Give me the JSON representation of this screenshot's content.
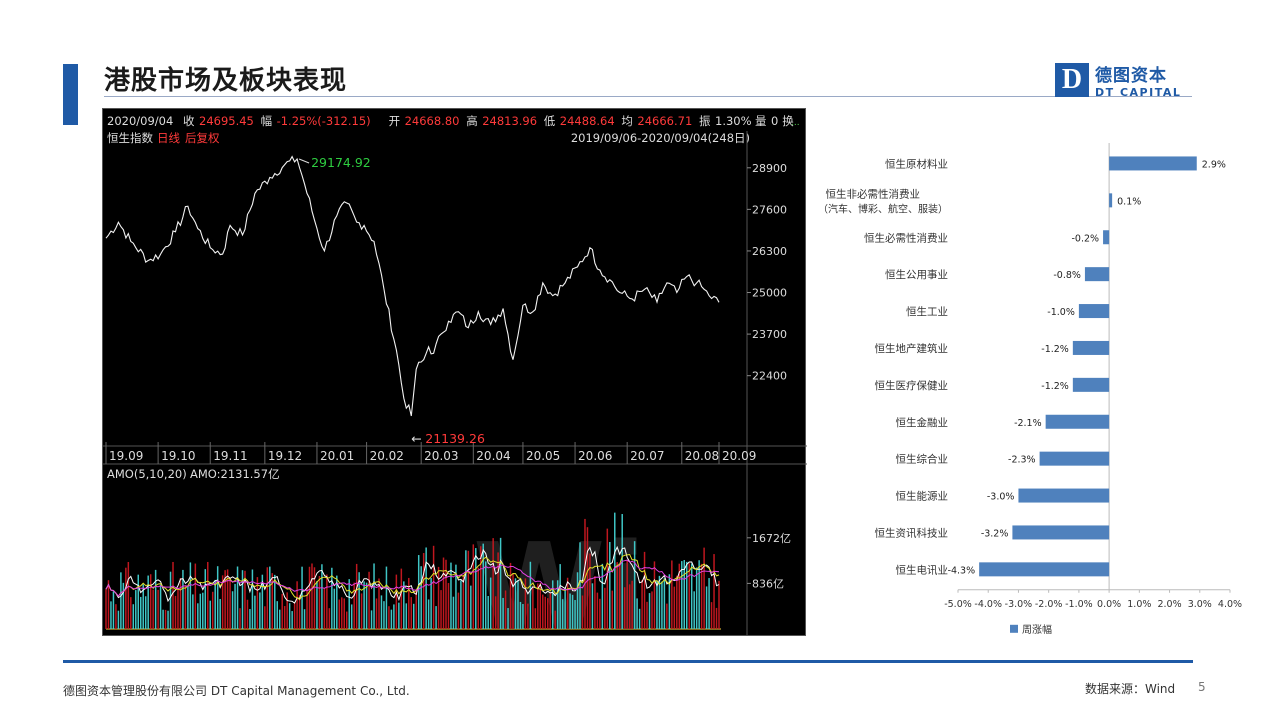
{
  "slide": {
    "title": "港股市场及板块表现",
    "logo_letter": "D",
    "logo_cn": "德图资本",
    "logo_en": "DT CAPITAL",
    "footer_left": "德图资本管理股份有限公司  DT Capital  Management  Co., Ltd.",
    "footer_source": "数据来源：Wind",
    "page_number": "5"
  },
  "chart_data": [
    {
      "type": "line",
      "title": "恒生指数",
      "header": {
        "date": "2020/09/04",
        "close_label": "收",
        "close": "24695.45",
        "change_label": "幅",
        "change": "-1.25%(-312.15)",
        "open_label": "开",
        "open": "24668.80",
        "high_label": "高",
        "high": "24813.96",
        "low_label": "低",
        "low": "24488.64",
        "avg_label": "均",
        "avg": "24666.71",
        "amp_label": "振",
        "amp": "1.30%",
        "vol_label": "量",
        "vol": "0",
        "turnover_label": "换",
        "period_tag": "日线",
        "adj_tag": "后复权",
        "range": "2019/09/06-2020/09/04(248日)"
      },
      "ylim": [
        21139.26,
        29174.92
      ],
      "y_ticks": [
        "28900",
        "27600",
        "26300",
        "25000",
        "23700",
        "22400"
      ],
      "x_ticks": [
        "19.09",
        "19.10",
        "19.11",
        "19.12",
        "20.01",
        "20.02",
        "20.03",
        "20.04",
        "20.05",
        "20.06",
        "20.07",
        "20.08",
        "20.09"
      ],
      "annotations": {
        "max": "29174.92",
        "min": "21139.26"
      },
      "series": [
        {
          "x": [
            0,
            5,
            10,
            17,
            22,
            28,
            33,
            37,
            42,
            47,
            50,
            55,
            60,
            66,
            72,
            77,
            80,
            85,
            88,
            93,
            97,
            101,
            104,
            108,
            112,
            117,
            120,
            123,
            125,
            128,
            130,
            132,
            135,
            138,
            142,
            146,
            150,
            155,
            160,
            164,
            168,
            172,
            176,
            180,
            185,
            190,
            195,
            199,
            203,
            207,
            212,
            217,
            222,
            226,
            230,
            234,
            238,
            241,
            243,
            247
          ],
          "values": [
            26700,
            27200,
            26600,
            26000,
            26200,
            26900,
            27700,
            27000,
            26400,
            26200,
            27100,
            26800,
            28100,
            28600,
            29000,
            29174.92,
            28400,
            27000,
            26300,
            27400,
            27800,
            27200,
            27100,
            26600,
            25100,
            23200,
            21700,
            21139.26,
            22600,
            22900,
            23300,
            23100,
            23700,
            24100,
            24400,
            23900,
            24400,
            24000,
            24500,
            22900,
            24600,
            24400,
            25300,
            24900,
            25300,
            25800,
            26400,
            25700,
            25400,
            25000,
            24800,
            25100,
            24700,
            25300,
            25000,
            25500,
            25300,
            25100,
            24900,
            24695.45
          ]
        }
      ]
    },
    {
      "type": "bar",
      "title": "AMO(5,10,20)",
      "amo_label": "AMO:2131.57亿",
      "y_ticks": [
        "1672亿",
        "836亿"
      ],
      "ylim": [
        0,
        2750
      ],
      "seed_levels": {
        "low": 750,
        "high": 1000
      }
    },
    {
      "type": "bar",
      "orientation": "horizontal",
      "categories": [
        "恒生原材料业",
        "恒生非必需性消费业\n（汽车、博彩、航空、服装）",
        "恒生必需性消费业",
        "恒生公用事业",
        "恒生工业",
        "恒生地产建筑业",
        "恒生医疗保健业",
        "恒生金融业",
        "恒生综合业",
        "恒生能源业",
        "恒生资讯科技业",
        "恒生电讯业"
      ],
      "values": [
        2.9,
        0.1,
        -0.2,
        -0.8,
        -1.0,
        -1.2,
        -1.2,
        -2.1,
        -2.3,
        -3.0,
        -3.2,
        -4.3
      ],
      "value_labels": [
        "2.9%",
        "0.1%",
        "-0.2%",
        "-0.8%",
        "-1.0%",
        "-1.2%",
        "-1.2%",
        "-2.1%",
        "-2.3%",
        "-3.0%",
        "-3.2%",
        "-4.3%"
      ],
      "xlim": [
        -5.0,
        4.0
      ],
      "x_ticks": [
        "-5.0%",
        "-4.0%",
        "-3.0%",
        "-2.0%",
        "-1.0%",
        "0.0%",
        "1.0%",
        "2.0%",
        "3.0%",
        "4.0%"
      ],
      "legend": "周涨幅",
      "colors": {
        "bar": "#4f81bd"
      }
    }
  ]
}
